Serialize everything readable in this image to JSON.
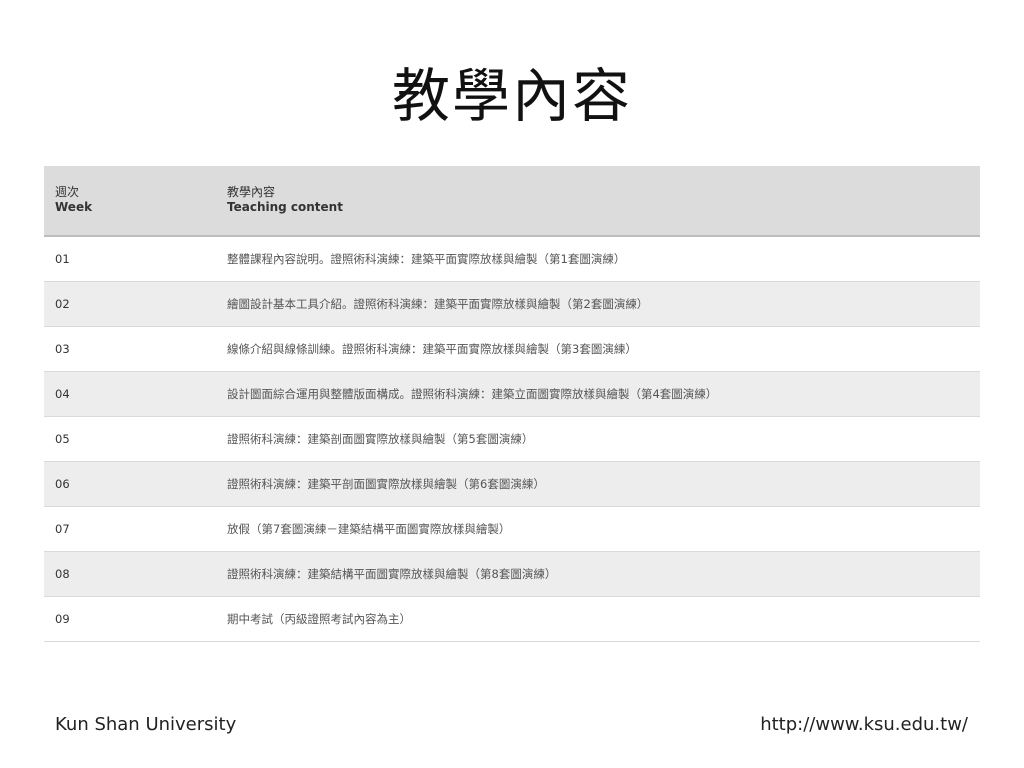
{
  "slide": {
    "title": "教學內容"
  },
  "table": {
    "header": {
      "week_zh": "週次",
      "week_en": "Week",
      "content_zh": "教學內容",
      "content_en": "Teaching content"
    },
    "rows": [
      {
        "week": "01",
        "content": "整體課程內容說明。證照術科演練：建築平面實際放樣與繪製（第1套圖演練）"
      },
      {
        "week": "02",
        "content": "繪圖設計基本工具介紹。證照術科演練：建築平面實際放樣與繪製（第2套圖演練）"
      },
      {
        "week": "03",
        "content": "線條介紹與線條訓練。證照術科演練：建築平面實際放樣與繪製（第3套圖演練）"
      },
      {
        "week": "04",
        "content": "設計圖面綜合運用與整體版面構成。證照術科演練：建築立面圖實際放樣與繪製（第4套圖演練）"
      },
      {
        "week": "05",
        "content": "證照術科演練：建築剖面圖實際放樣與繪製（第5套圖演練）"
      },
      {
        "week": "06",
        "content": "證照術科演練：建築平剖面圖實際放樣與繪製（第6套圖演練）"
      },
      {
        "week": "07",
        "content": "放假（第7套圖演練－建築結構平面圖實際放樣與繪製）"
      },
      {
        "week": "08",
        "content": "證照術科演練：建築結構平面圖實際放樣與繪製（第8套圖演練）"
      },
      {
        "week": "09",
        "content": "期中考試（丙級證照考試內容為主）"
      }
    ]
  },
  "footer": {
    "left": "Kun Shan University",
    "right": "http://www.ksu.edu.tw/"
  }
}
